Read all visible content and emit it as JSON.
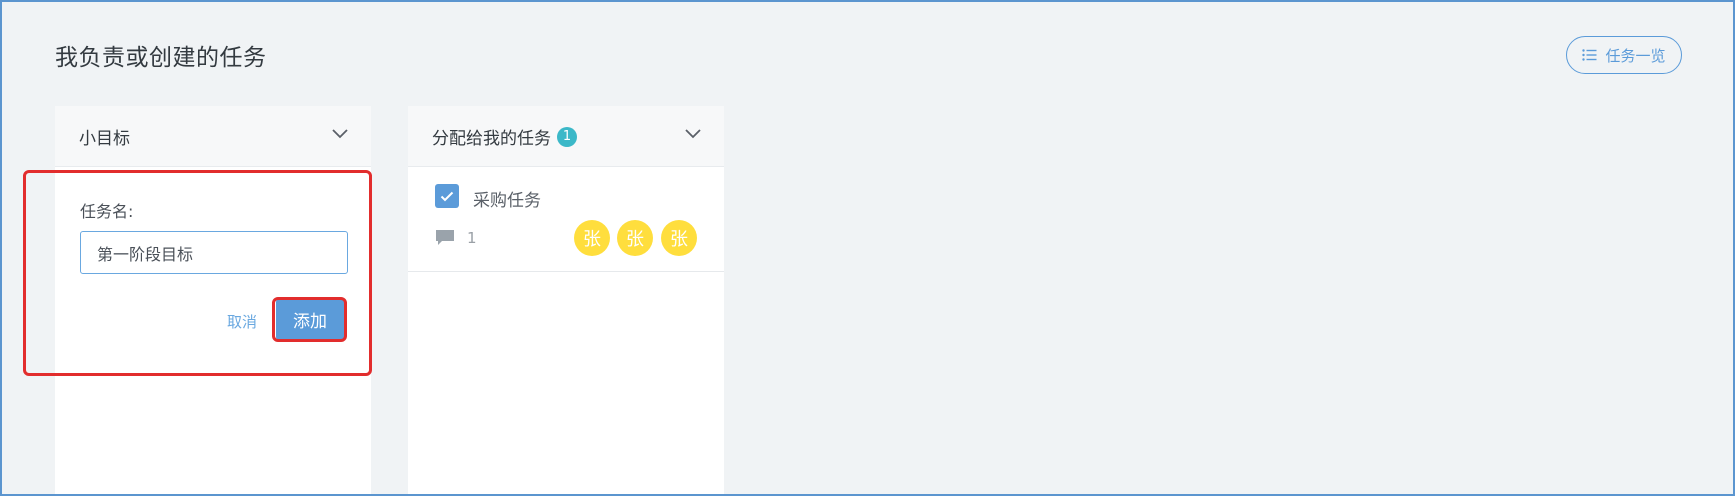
{
  "page": {
    "title": "我负责或创建的任务",
    "overview_button": "任务一览",
    "overview_icon": "list-icon"
  },
  "columns": [
    {
      "title": "小目标",
      "form": {
        "label": "任务名:",
        "input_value": "第一阶段目标",
        "cancel_label": "取消",
        "add_label": "添加"
      }
    },
    {
      "title": "分配给我的任务",
      "badge": "1",
      "tasks": [
        {
          "name": "采购任务",
          "checked": true,
          "comment_count": "1",
          "assignees": [
            "张",
            "张",
            "张"
          ]
        }
      ]
    }
  ],
  "colors": {
    "accent": "#5b9bd9",
    "badge": "#3bb8c8",
    "avatar": "#ffde3d",
    "highlight": "#e22d2d"
  }
}
